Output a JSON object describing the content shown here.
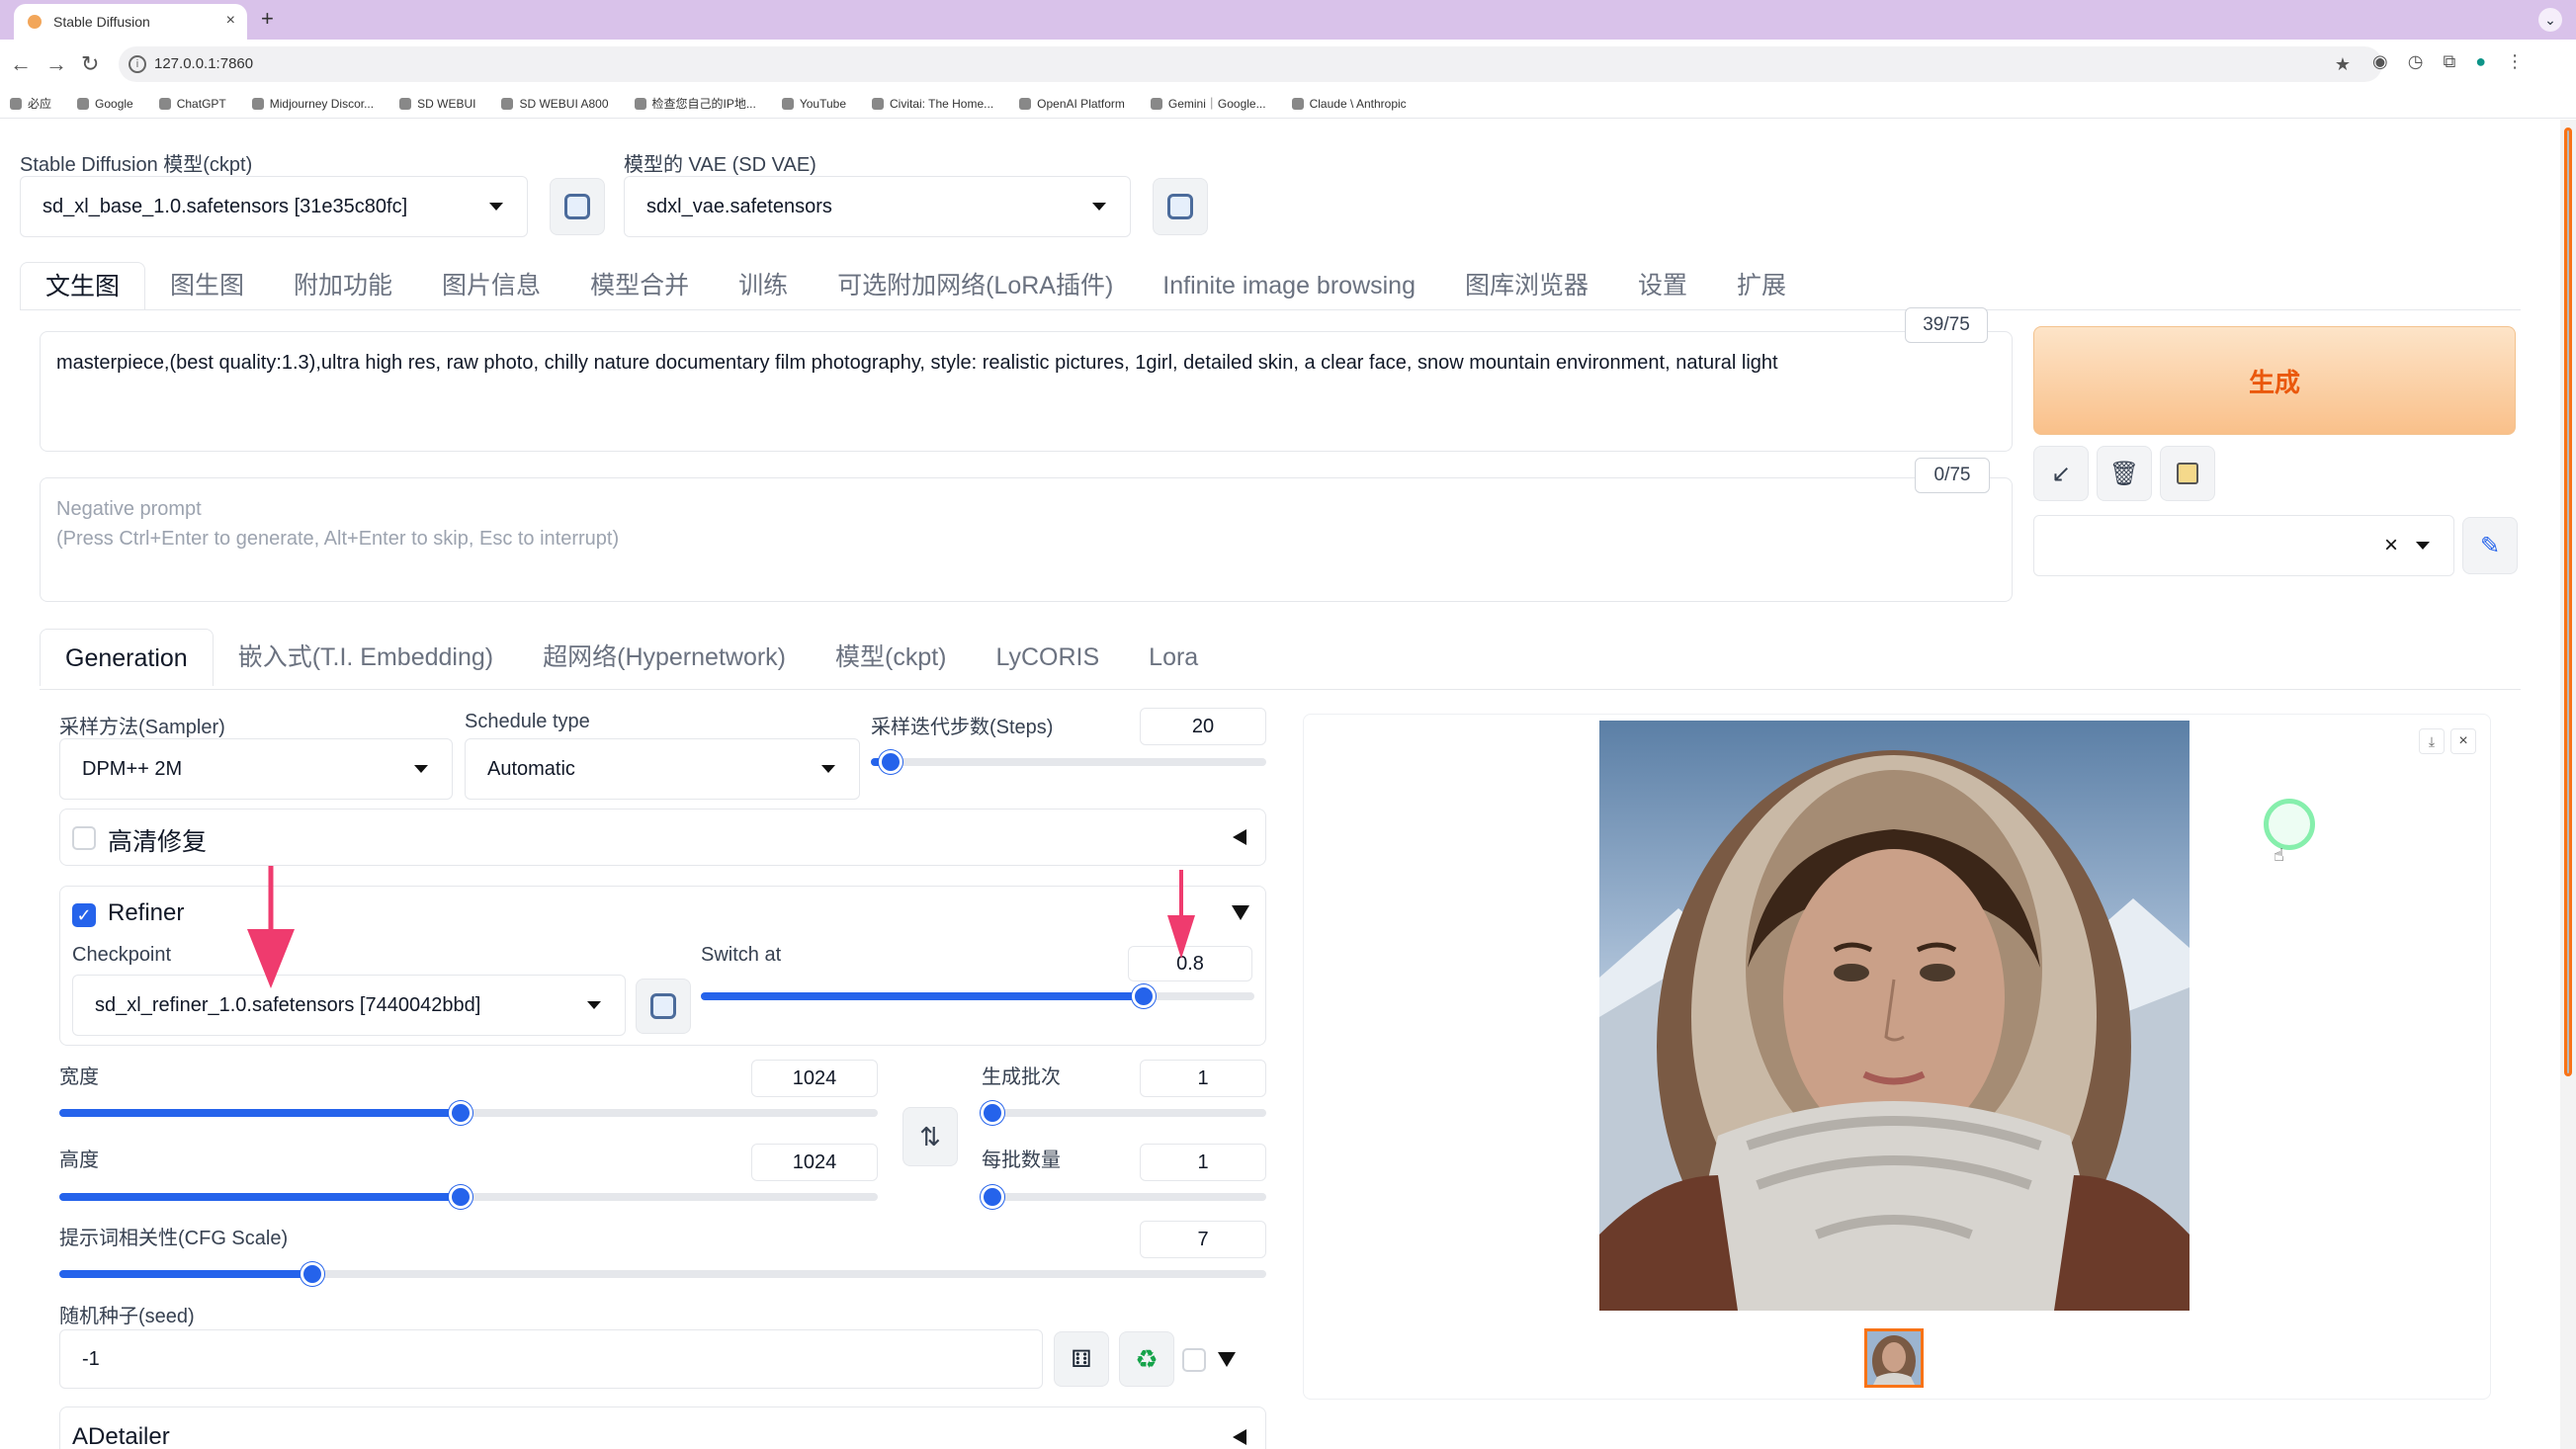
{
  "browser": {
    "tab_title": "Stable Diffusion",
    "new_tab": "+",
    "close_tab": "×",
    "url": "127.0.0.1:7860",
    "bookmarks": [
      "必应",
      "Google",
      "ChatGPT",
      "Midjourney Discor...",
      "SD WEBUI",
      "SD WEBUI A800",
      "检查您自己的IP地...",
      "YouTube",
      "Civitai: The Home...",
      "OpenAI Platform",
      "Gemini｜Google...",
      "Claude \\ Anthropic"
    ]
  },
  "header": {
    "ckpt_label": "Stable Diffusion 模型(ckpt)",
    "ckpt_value": "sd_xl_base_1.0.safetensors [31e35c80fc]",
    "vae_label": "模型的 VAE (SD VAE)",
    "vae_value": "sdxl_vae.safetensors"
  },
  "main_tabs": [
    "文生图",
    "图生图",
    "附加功能",
    "图片信息",
    "模型合并",
    "训练",
    "可选附加网络(LoRA插件)",
    "Infinite image browsing",
    "图库浏览器",
    "设置",
    "扩展"
  ],
  "prompt": {
    "text": "masterpiece,(best quality:1.3),ultra high res, raw photo, chilly nature documentary film photography, style: realistic pictures, 1girl, detailed skin, a clear face, snow mountain environment, natural light",
    "counter": "39/75"
  },
  "negative_prompt": {
    "placeholder_line1": "Negative prompt",
    "placeholder_line2": "(Press Ctrl+Enter to generate, Alt+Enter to skip, Esc to interrupt)",
    "counter": "0/75"
  },
  "generate_label": "生成",
  "style_clear": "×",
  "sub_tabs": [
    "Generation",
    "嵌入式(T.I. Embedding)",
    "超网络(Hypernetwork)",
    "模型(ckpt)",
    "LyCORIS",
    "Lora"
  ],
  "generation": {
    "sampler_label": "采样方法(Sampler)",
    "sampler_value": "DPM++ 2M",
    "schedule_label": "Schedule type",
    "schedule_value": "Automatic",
    "steps_label": "采样迭代步数(Steps)",
    "steps_value": "20",
    "hires_label": "高清修复",
    "refiner_label": "Refiner",
    "checkpoint_label": "Checkpoint",
    "checkpoint_value": "sd_xl_refiner_1.0.safetensors [7440042bbd]",
    "switch_label": "Switch at",
    "switch_value": "0.8",
    "width_label": "宽度",
    "width_value": "1024",
    "height_label": "高度",
    "height_value": "1024",
    "batch_count_label": "生成批次",
    "batch_count_value": "1",
    "batch_size_label": "每批数量",
    "batch_size_value": "1",
    "cfg_label": "提示词相关性(CFG Scale)",
    "cfg_value": "7",
    "seed_label": "随机种子(seed)",
    "seed_value": "-1",
    "adetailer_label": "ADetailer"
  },
  "slider_levels": {
    "steps": 0.05,
    "switch_at": 0.8,
    "width": 0.49,
    "height": 0.49,
    "batch_count": 0.0,
    "batch_size": 0.0,
    "cfg": 0.21
  },
  "colors": {
    "accent": "#2563eb",
    "generate_text": "#ea580c",
    "annotation_arrow": "#ef3b6e"
  }
}
